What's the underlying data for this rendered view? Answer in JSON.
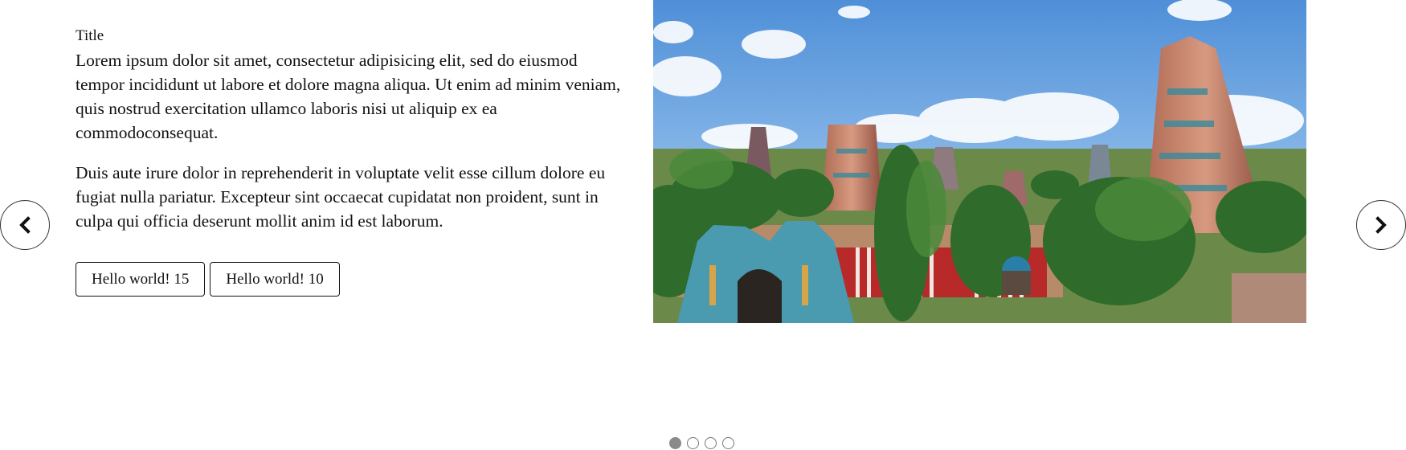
{
  "slide": {
    "title": "Title",
    "paragraphs": [
      "Lorem ipsum dolor sit amet, consectetur adipisicing elit, sed do eiusmod tempor incididunt ut labore et dolore magna aliqua. Ut enim ad minim veniam, quis nostrud exercitation ullamco laboris nisi ut aliquip ex ea commodoconsequat.",
      "Duis aute irure dolor in reprehenderit in voluptate velit esse cillum dolore eu fugiat nulla pariatur. Excepteur sint occaecat cupidatat non proident, sunt in culpa qui officia deserunt mollit anim id est laborum."
    ],
    "buttons": [
      {
        "label": "Hello world! 15"
      },
      {
        "label": "Hello world! 10"
      }
    ]
  },
  "navigation": {
    "prev_icon": "chevron-left-icon",
    "next_icon": "chevron-right-icon"
  },
  "pagination": {
    "total": 4,
    "active_index": 0
  },
  "colors": {
    "sky": "#6fa8e0",
    "foliage": "#2f6b2a",
    "temple_accent": "#c7503a"
  }
}
